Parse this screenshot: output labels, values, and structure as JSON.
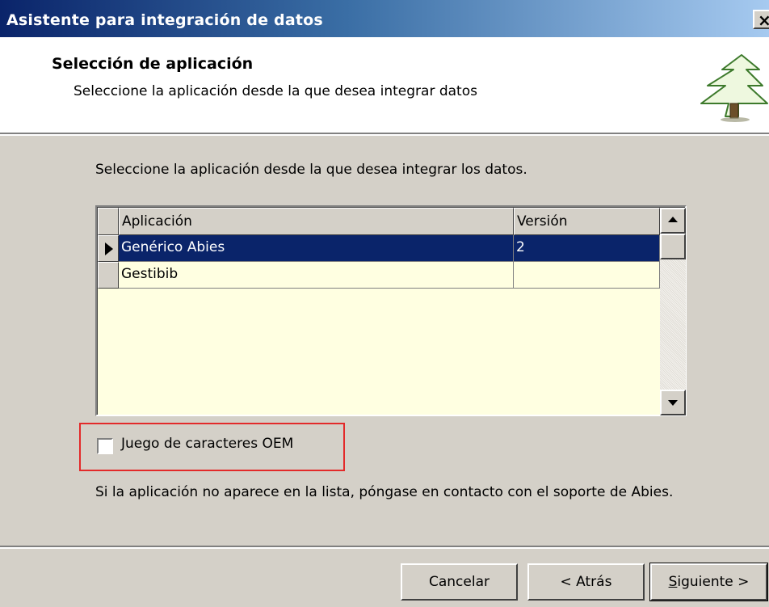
{
  "window": {
    "title": "Asistente para integración de datos",
    "close_label": "×"
  },
  "header": {
    "title": "Selección de aplicación",
    "subtitle": "Seleccione la aplicación desde la que desea integrar datos",
    "icon": "tree-icon"
  },
  "main": {
    "instruction": "Seleccione la aplicación desde la que desea integrar los datos.",
    "grid": {
      "columns": [
        "Aplicación",
        "Versión"
      ],
      "rows": [
        {
          "app": "Genérico Abies",
          "version": "2",
          "selected": true
        },
        {
          "app": "Gestibib",
          "version": "",
          "selected": false
        }
      ]
    },
    "oem_checkbox": {
      "label": "Juego de caracteres OEM",
      "checked": false
    },
    "footnote": "Si la aplicación no aparece en la lista, póngase en contacto con el soporte de Abies."
  },
  "buttons": {
    "cancel": "Cancelar",
    "back": "< Atrás",
    "next_prefix": "S",
    "next_rest": "iguiente >"
  },
  "colors": {
    "title_bar_start": "#0a246a",
    "title_bar_end": "#a6caf0",
    "selection": "#0a246a",
    "grid_background": "#ffffe1",
    "highlight_box": "#e32a2a"
  }
}
